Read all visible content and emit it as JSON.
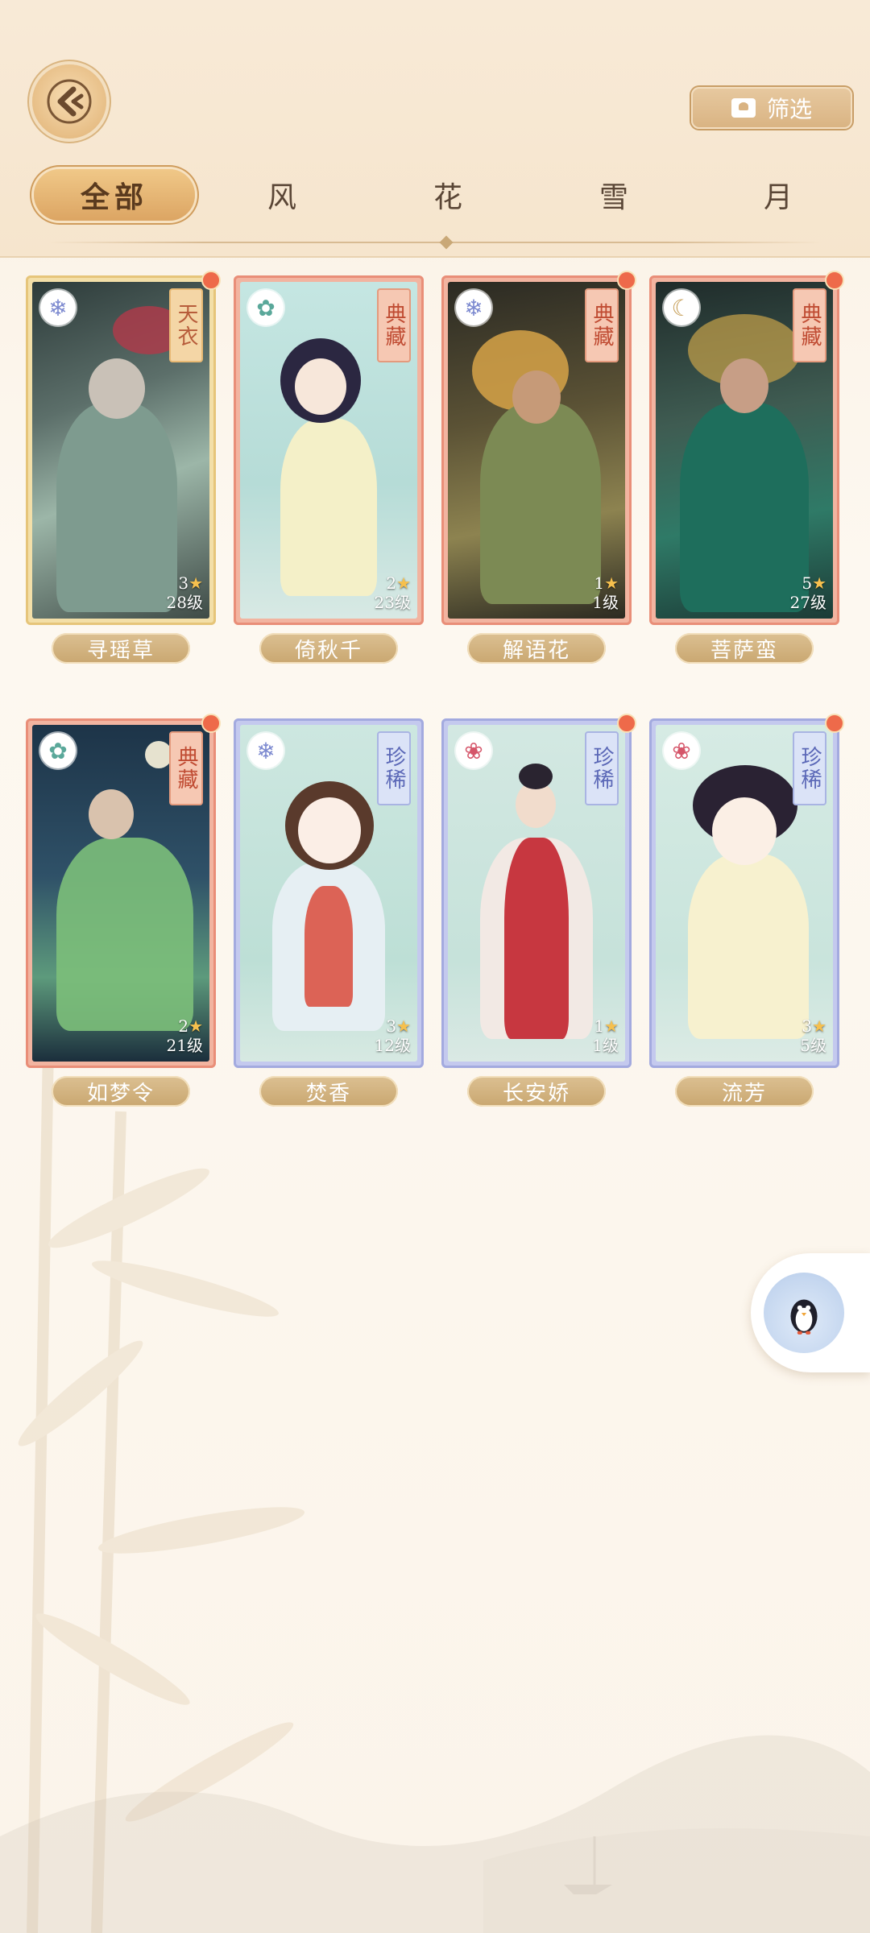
{
  "header": {
    "filter_label": "筛选",
    "tabs": [
      {
        "label": "全部",
        "active": true
      },
      {
        "label": "风",
        "active": false
      },
      {
        "label": "花",
        "active": false
      },
      {
        "label": "雪",
        "active": false
      },
      {
        "label": "月",
        "active": false
      }
    ]
  },
  "cards": [
    {
      "name": "寻瑶草",
      "rarity": "天衣",
      "rarity_color": "gold",
      "frame": "gold",
      "element_icon": "snowflake-icon",
      "stars": "3",
      "level": "28级"
    },
    {
      "name": "倚秋千",
      "rarity": "典藏",
      "rarity_color": "red",
      "frame": "red",
      "element_icon": "wind-icon",
      "stars": "2",
      "level": "23级"
    },
    {
      "name": "解语花",
      "rarity": "典藏",
      "rarity_color": "red",
      "frame": "red",
      "element_icon": "snowflake-icon",
      "stars": "1",
      "level": "1级"
    },
    {
      "name": "菩萨蛮",
      "rarity": "典藏",
      "rarity_color": "red",
      "frame": "red",
      "element_icon": "moon-icon",
      "stars": "5",
      "level": "27级"
    },
    {
      "name": "如梦令",
      "rarity": "典藏",
      "rarity_color": "red",
      "frame": "red",
      "element_icon": "wind-icon",
      "stars": "2",
      "level": "21级"
    },
    {
      "name": "焚香",
      "rarity": "珍稀",
      "rarity_color": "blue",
      "frame": "blue",
      "element_icon": "snowflake-icon",
      "stars": "3",
      "level": "12级"
    },
    {
      "name": "长安娇",
      "rarity": "珍稀",
      "rarity_color": "blue",
      "frame": "blue",
      "element_icon": "lotus-icon",
      "stars": "1",
      "level": "1级"
    },
    {
      "name": "流芳",
      "rarity": "珍稀",
      "rarity_color": "blue",
      "frame": "blue",
      "element_icon": "lotus-icon",
      "stars": "3",
      "level": "5级"
    }
  ],
  "colors": {
    "accent": "#dca563",
    "name_plate": "#c9a770",
    "new_dot": "#ee6a4a"
  }
}
